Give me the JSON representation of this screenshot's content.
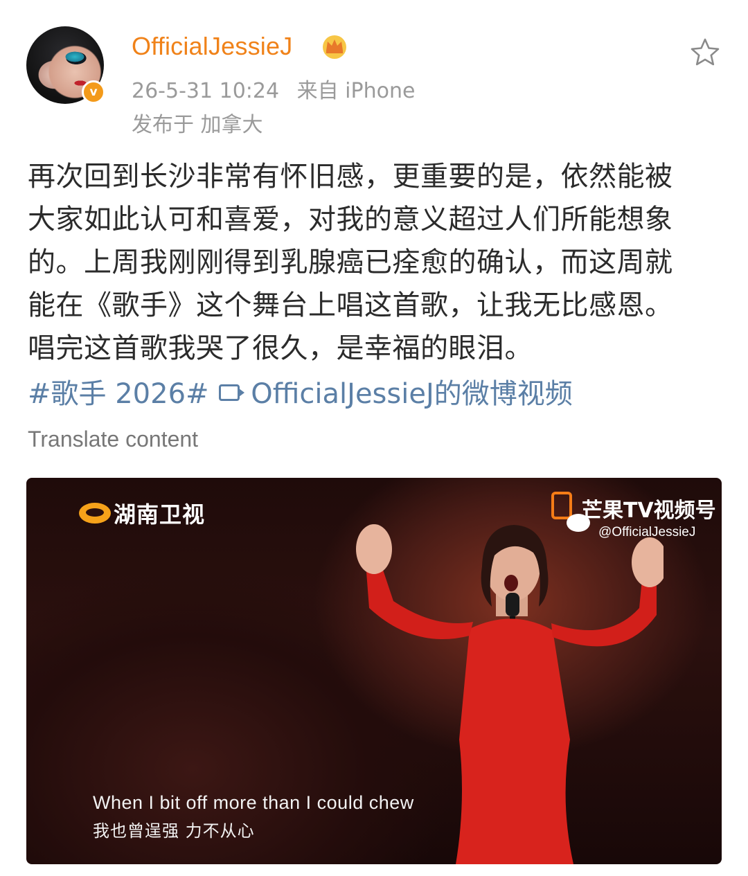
{
  "post": {
    "username": "OfficialJessieJ",
    "date": "26-5-31 10:24",
    "source": "来自 iPhone",
    "location": "发布于 加拿大",
    "verified_badge": "v",
    "text_lines": [
      "再次回到长沙非常有怀旧感，更重要的是，依然能被",
      "大家如此认可和喜爱，对我的意义超过人们所能想象",
      "的。上周我刚刚得到乳腺癌已痊愈的确认，而这周就",
      "能在《歌手》这个舞台上唱这首歌，让我无比感恩。",
      "唱完这首歌我哭了很久，是幸福的眼泪。"
    ],
    "hashtag": "#歌手 2026#",
    "video_link": "OfficialJessieJ的微博视频",
    "translate_label": "Translate content",
    "icons": {
      "favorite": "star-outline-icon",
      "member": "crown-icon",
      "video": "video-icon"
    },
    "colors": {
      "username": "#f08219",
      "link": "#5b7fa6",
      "meta": "#9a9a9a",
      "accent_badge": "#f39a1a"
    }
  },
  "video": {
    "channel_logo": "湖南卫视",
    "brand_text": "芒果TV视频号",
    "watermark_handle": "@OfficialJessieJ",
    "subtitle_en": "When I bit off more than I could chew",
    "subtitle_zh": "我也曾逞强 力不从心"
  }
}
